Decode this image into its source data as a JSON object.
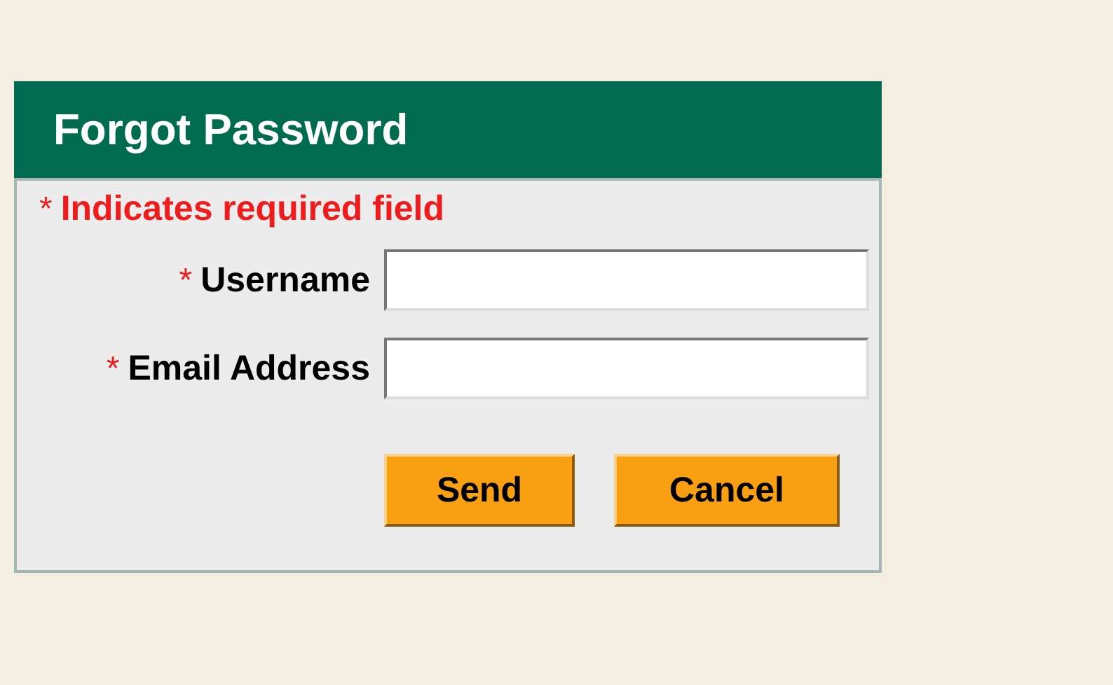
{
  "panel": {
    "title": "Forgot Password"
  },
  "required_note": {
    "marker": "*",
    "text": "Indicates required field"
  },
  "fields": [
    {
      "marker": "*",
      "label": "Username"
    },
    {
      "marker": "*",
      "label": "Email Address"
    }
  ],
  "buttons": [
    "Send",
    "Cancel"
  ]
}
